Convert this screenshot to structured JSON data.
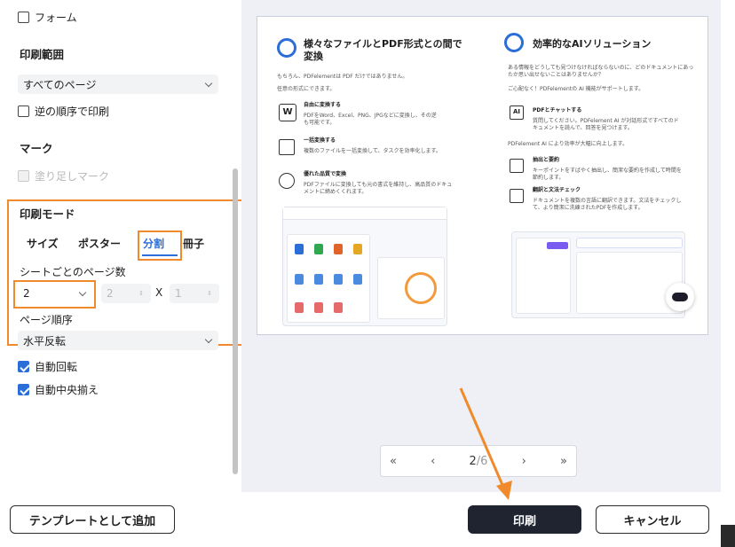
{
  "form_checkbox": {
    "label": "フォーム",
    "checked": false
  },
  "print_range": {
    "heading": "印刷範囲",
    "select_value": "すべてのページ",
    "reverse_label": "逆の順序で印刷",
    "reverse_checked": false
  },
  "marks": {
    "heading": "マーク",
    "bleed_label": "塗り足しマーク",
    "bleed_checked": false
  },
  "print_mode": {
    "heading": "印刷モード",
    "tabs": [
      "サイズ",
      "ポスター",
      "分割",
      "冊子"
    ],
    "active_tab": "分割",
    "pages_per_sheet_label": "シートごとのページ数",
    "pages_per_sheet_value": "2",
    "cols_value": "2",
    "x_label": "X",
    "rows_value": "1",
    "page_order_label": "ページ順序",
    "page_order_value": "水平反転"
  },
  "auto_rotate": {
    "label": "自動回転",
    "checked": true
  },
  "auto_center": {
    "label": "自動中央揃え",
    "checked": true
  },
  "preview": {
    "left_title": "様々なファイルとPDF形式との間で変換",
    "left_sub1": "もちろん、PDFelementは PDF だけではありません。",
    "left_sub2": "任意の形式にできます。",
    "left_items": [
      {
        "title": "自由に変換する",
        "desc": "PDFをWord、Excel、PNG、JPGなどに変換し、その逆も可能です。"
      },
      {
        "title": "一括変換する",
        "desc": "複数のファイルを一括変換して、タスクを効率化します。"
      },
      {
        "title": "優れた品質で変換",
        "desc": "PDFファイルに変換しても元の書式を維持し、高品質のドキュメントに締めくくれます。"
      }
    ],
    "right_title": "効率的なAIソリューション",
    "right_sub1": "ある情報をどうしても見つけなければならないのに、どのドキュメントにあったか思い出せないことはありませんか？",
    "right_sub2": "ご心配なく！PDFelementの AI 機能がサポートします。",
    "right_items": [
      {
        "title": "PDFとチャットする",
        "desc": "質問してください。PDFelement AI が対話形式ですべてのドキュメントを読んで、回答を見つけます。"
      },
      {
        "title": "PDFelement AI により効率が大幅に向上します。",
        "desc": ""
      },
      {
        "title": "抽出と要約",
        "desc": "キーポイントをすばやく抽出し、簡潔な要約を作成して時間を節約します。"
      },
      {
        "title": "翻訳と文法チェック",
        "desc": "ドキュメントを複数の言語に翻訳できます。文法をチェックして、より簡潔に洗練されたPDFを作成します。"
      }
    ]
  },
  "pager": {
    "first": "«",
    "prev": "‹",
    "current": "2",
    "total": "/6",
    "next": "›",
    "last": "»"
  },
  "buttons": {
    "add_template": "テンプレートとして追加",
    "print": "印刷",
    "cancel": "キャンセル"
  },
  "colors": {
    "accent_orange": "#f08a2c",
    "primary_blue": "#2b6ed8",
    "dark_button": "#1f2430",
    "preview_bg": "#eef0f5"
  }
}
